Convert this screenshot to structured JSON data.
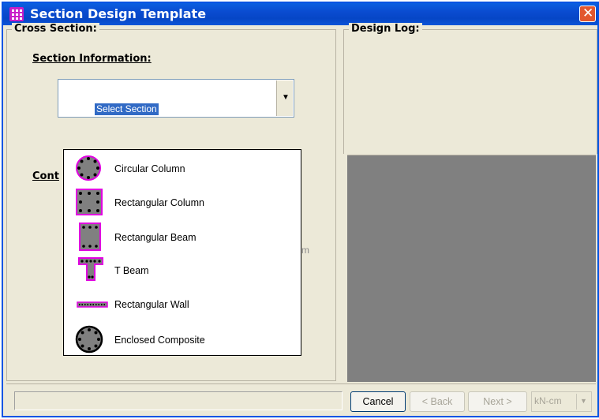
{
  "window": {
    "title": "Section Design Template"
  },
  "cross_section": {
    "group_label": "Cross Section:",
    "section_info_label": "Section Information:",
    "section_combo_value": "Select Section",
    "cont_label": "Cont",
    "unit_label": "cm"
  },
  "design_log": {
    "group_label": "Design Log:"
  },
  "dropdown": {
    "items": [
      {
        "label": "Circular Column",
        "icon": "circular-column-icon"
      },
      {
        "label": "Rectangular Column",
        "icon": "rectangular-column-icon"
      },
      {
        "label": "Rectangular Beam",
        "icon": "rectangular-beam-icon"
      },
      {
        "label": "T Beam",
        "icon": "t-beam-icon"
      },
      {
        "label": "Rectangular Wall",
        "icon": "rectangular-wall-icon"
      },
      {
        "label": "Enclosed Composite",
        "icon": "enclosed-composite-icon"
      }
    ]
  },
  "footer": {
    "cancel_label": "Cancel",
    "back_label": "< Back",
    "next_label": "Next >",
    "units_value": "kN-cm"
  },
  "colors": {
    "titlebar": "#0a4bd0",
    "accent_magenta": "#e000e0",
    "graphics_bg": "#808080"
  }
}
